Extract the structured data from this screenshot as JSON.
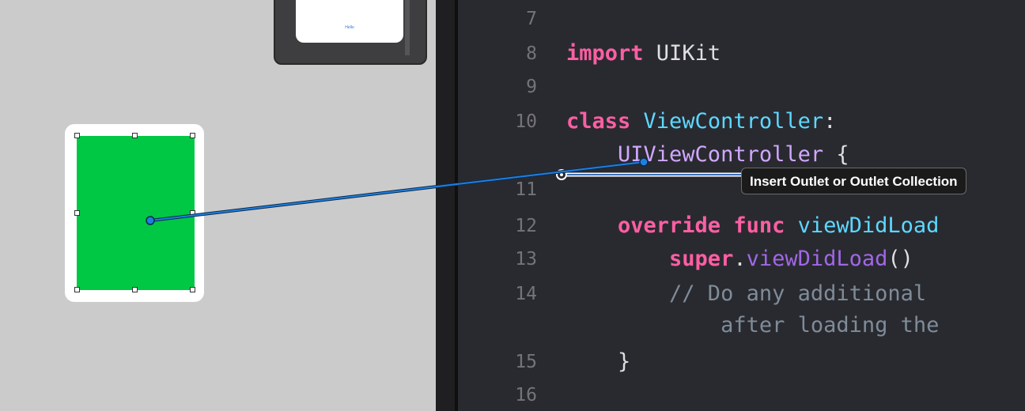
{
  "storyboard": {
    "scene_caption": "Hello"
  },
  "editor": {
    "lines": [
      {
        "number": "7",
        "parts": []
      },
      {
        "number": "8",
        "parts": [
          {
            "text": "import",
            "style": "kw"
          },
          {
            "text": " UIKit",
            "style": "plain"
          }
        ]
      },
      {
        "number": "9",
        "parts": []
      },
      {
        "number": "10",
        "parts": [
          {
            "text": "class",
            "style": "kw"
          },
          {
            "text": " ViewController",
            "style": "type"
          },
          {
            "text": ":",
            "style": "plain"
          }
        ]
      },
      {
        "number": "",
        "parts": [
          {
            "text": "    UIViewController",
            "style": "systype"
          },
          {
            "text": " {",
            "style": "plain"
          }
        ]
      },
      {
        "number": "11",
        "parts": []
      },
      {
        "number": "",
        "parts": []
      },
      {
        "number": "12",
        "parts": [
          {
            "text": "    override",
            "style": "kw"
          },
          {
            "text": " func",
            "style": "kw"
          },
          {
            "text": " viewDidLoad",
            "style": "type"
          }
        ]
      },
      {
        "number": "13",
        "parts": [
          {
            "text": "        super",
            "style": "kw"
          },
          {
            "text": ".",
            "style": "plain"
          },
          {
            "text": "viewDidLoad",
            "style": "method"
          },
          {
            "text": "()",
            "style": "plain"
          }
        ]
      },
      {
        "number": "14",
        "parts": [
          {
            "text": "        // Do any additional",
            "style": "comment"
          }
        ]
      },
      {
        "number": "",
        "parts": [
          {
            "text": "            after loading the",
            "style": "comment"
          }
        ]
      },
      {
        "number": "15",
        "parts": [
          {
            "text": "    }",
            "style": "plain"
          }
        ]
      },
      {
        "number": "16",
        "parts": []
      }
    ]
  },
  "tooltip": {
    "label": "Insert Outlet or Outlet Collection"
  },
  "colors": {
    "connection_line": "#1f7fe0",
    "green_view": "#00c844",
    "editor_background": "#292a30"
  }
}
